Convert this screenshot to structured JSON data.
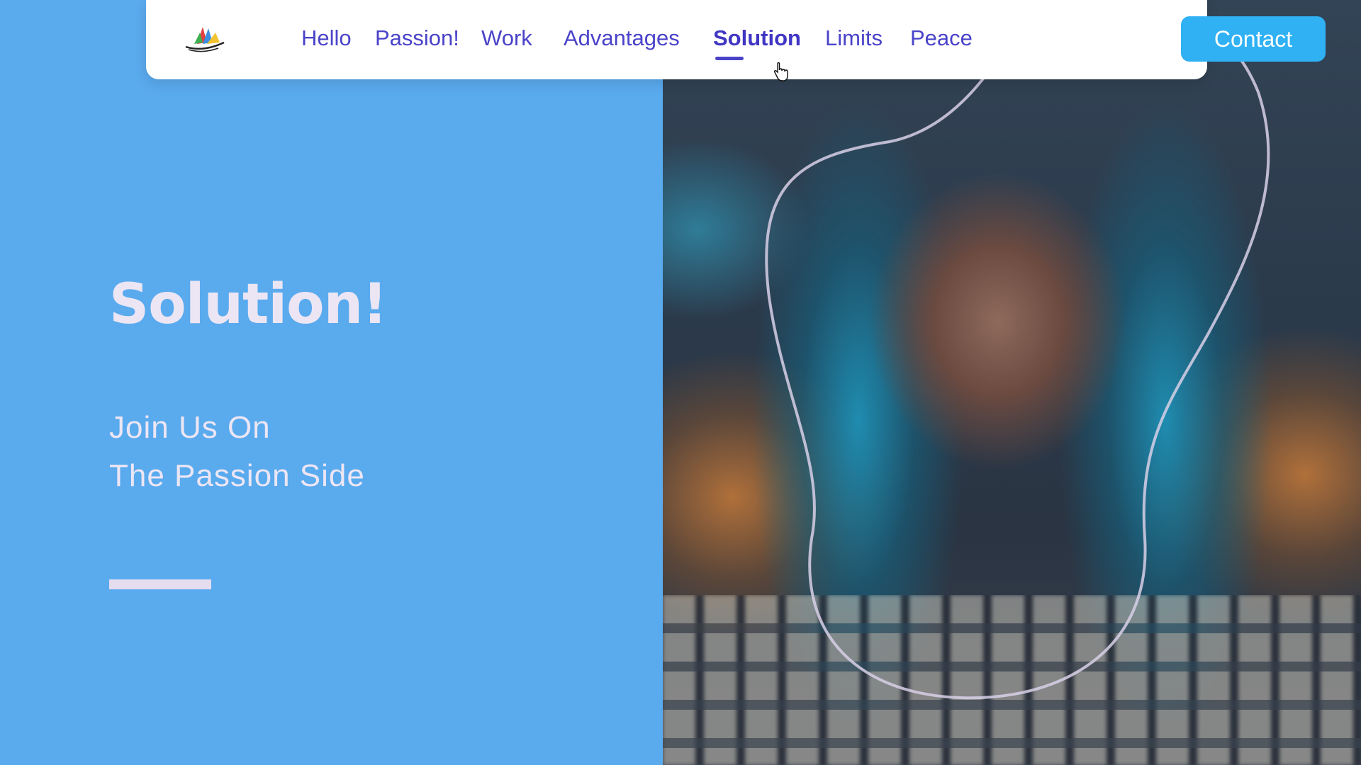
{
  "nav": {
    "items": [
      {
        "label": "Hello"
      },
      {
        "label": "Passion!"
      },
      {
        "label": "Work"
      },
      {
        "label": "Advantages"
      },
      {
        "label": "Solution",
        "active": true
      },
      {
        "label": "Limits"
      },
      {
        "label": "Peace"
      }
    ],
    "contact_label": "Contact"
  },
  "hero": {
    "title": "Solution!",
    "subtitle_line1": "Join Us On",
    "subtitle_line2": "The Passion Side"
  },
  "colors": {
    "background": "#5aaaee",
    "nav_text": "#4a43c9",
    "contact_button": "#2fb1f4",
    "hero_text": "#ece6f4"
  },
  "icons": {
    "logo": "boat-logo-icon",
    "cursor": "hand-pointer-icon"
  }
}
